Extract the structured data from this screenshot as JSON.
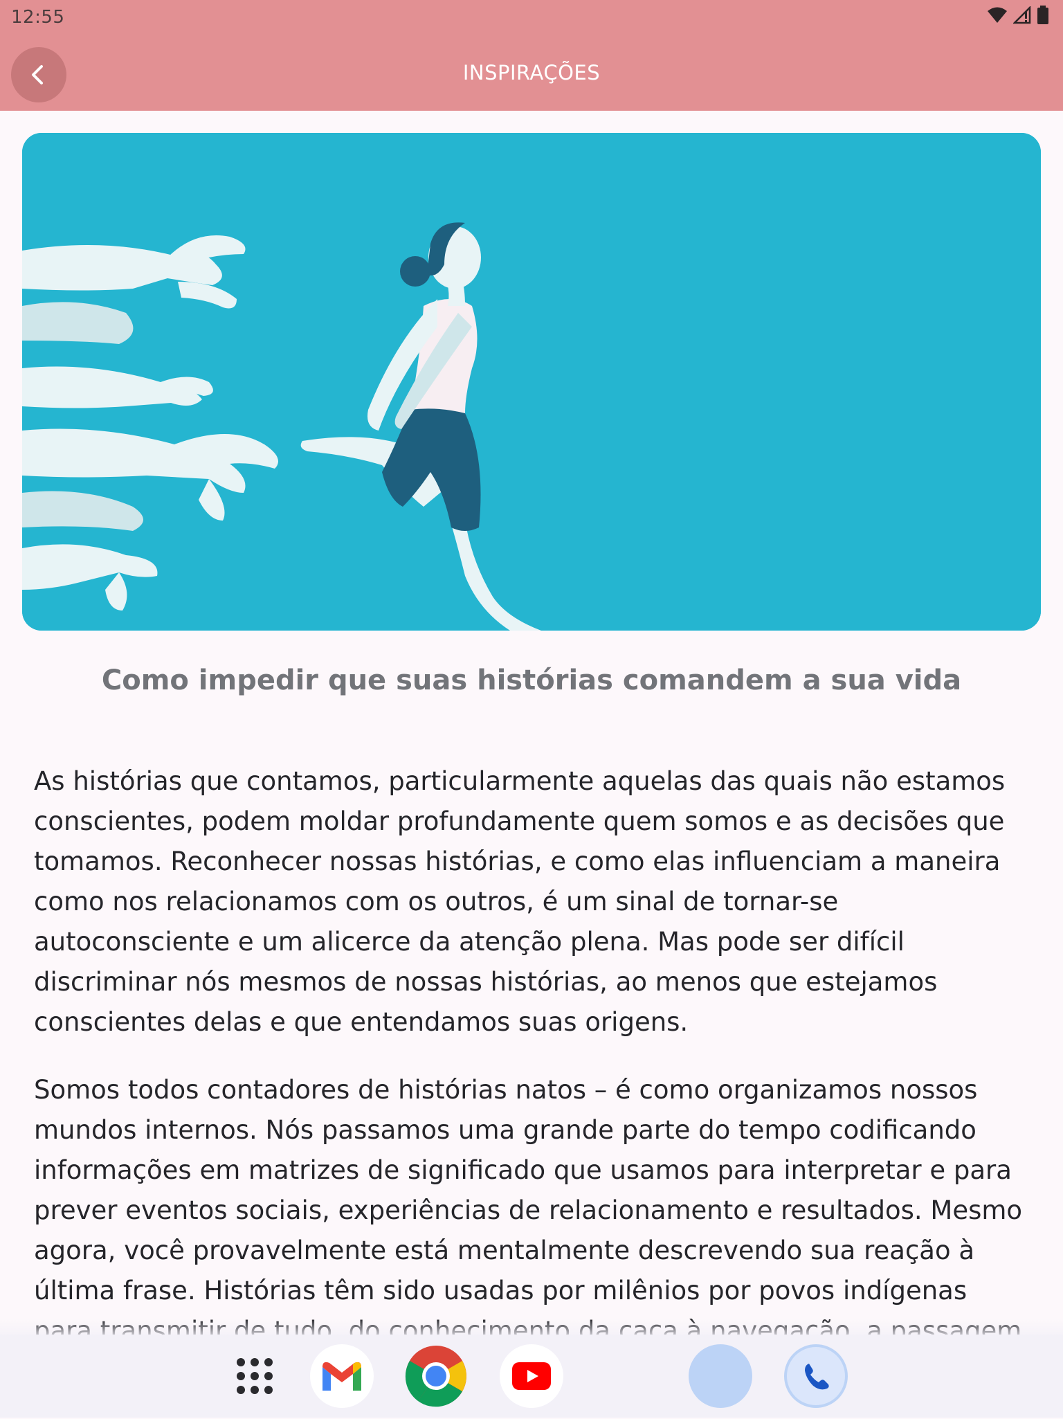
{
  "status_bar": {
    "time": "12:55",
    "icons": [
      "wifi-icon",
      "signal-icon",
      "battery-icon"
    ]
  },
  "app_bar": {
    "title": "INSPIRAÇÕES",
    "back_icon": "chevron-left-icon"
  },
  "article": {
    "title": "Como impedir que suas histórias comandem a sua vida",
    "paragraphs": [
      "As histórias que contamos, particularmente aquelas das quais não estamos conscientes, podem moldar profundamente quem somos e as decisões que tomamos. Reconhecer nossas histórias, e como elas influenciam a maneira como nos relacionamos com os outros, é um sinal de tornar-se autoconsciente e um alicerce da atenção plena. Mas pode ser difícil discriminar nós mesmos de nossas histórias, ao menos que estejamos conscientes delas e que entendamos suas origens.",
      "Somos todos contadores de histórias natos – é como organizamos nossos mundos internos. Nós passamos uma grande parte do tempo codificando informações em matrizes de significado que usamos para interpretar e para prever eventos sociais, experiências de relacionamento e resultados. Mesmo agora, você provavelmente está mentalmente descrevendo sua reação à última frase. Histórias têm sido usadas por milênios por povos indígenas para transmitir de tudo, do conhecimento da caça à navegação, a passagem de"
    ]
  },
  "colors": {
    "app_bar": "#e29093",
    "hero_background": "#25b5d0",
    "page_background": "#fdf8fb"
  },
  "dock": {
    "apps": [
      "app-drawer-icon",
      "gmail-icon",
      "chrome-icon",
      "youtube-icon",
      "assistant-icon",
      "phone-icon"
    ]
  }
}
